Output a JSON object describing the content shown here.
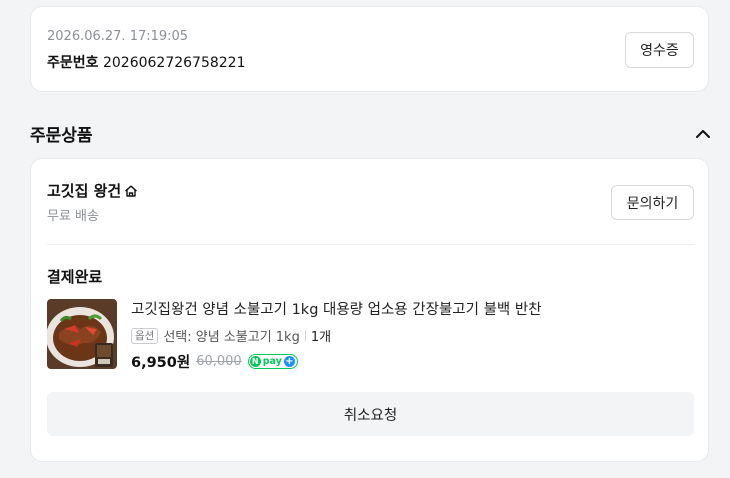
{
  "order": {
    "datetime": "2026.06.27. 17:19:05",
    "number_label": "주문번호",
    "number": "2026062726758221",
    "receipt_button": "영수증"
  },
  "section": {
    "title": "주문상품",
    "collapse_icon": "chevron-up-icon"
  },
  "store": {
    "name": "고깃집 왕건",
    "icon": "home-icon",
    "delivery": "무료 배송",
    "inquiry_button": "문의하기"
  },
  "item": {
    "status": "결제완료",
    "name": "고깃집왕건 양념 소불고기 1kg 대용량 업소용 간장불고기 불백 반찬",
    "option_tag": "옵션",
    "option": "선택: 양념 소불고기 1kg",
    "quantity": "1개",
    "price": "6,950원",
    "original_price": "60,000",
    "npay_badge": "pay",
    "npay_n": "N",
    "npay_plus": "+"
  },
  "actions": {
    "cancel_button": "취소요청"
  },
  "colors": {
    "npay_green": "#03c75a",
    "npay_blue": "#1f8ff2",
    "background": "#f3f4f6"
  }
}
